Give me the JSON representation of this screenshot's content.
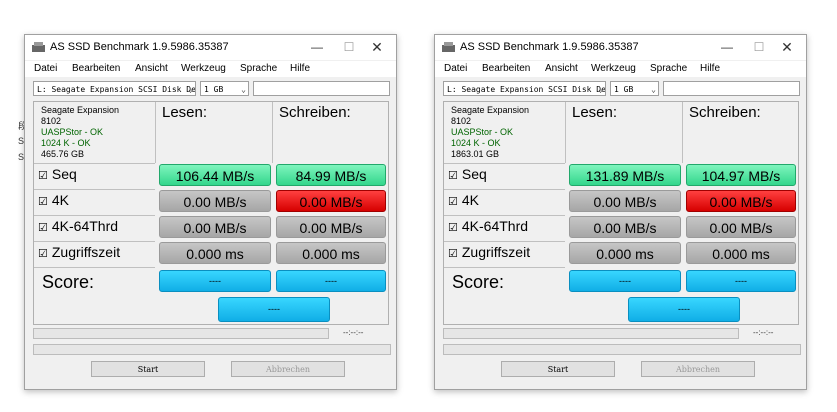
{
  "menu": [
    "Datei",
    "Bearbeiten",
    "Ansicht",
    "Werkzeug",
    "Sprache",
    "Hilfe"
  ],
  "windows": [
    {
      "title": "AS SSD Benchmark 1.9.5986.35387",
      "drive_select": "L: Seagate Expansion SCSI Disk De",
      "size_select": "1 GB",
      "info": {
        "name": "Seagate Expansion",
        "model": "8102",
        "driver": "UASPStor - OK",
        "align": "1024 K - OK",
        "capacity": "465.76 GB"
      },
      "col_read": "Lesen:",
      "col_write": "Schreiben:",
      "rows": [
        {
          "label": "Seq",
          "read": "106.44 MB/s",
          "write": "84.99 MB/s"
        },
        {
          "label": "4K",
          "read": "0.00 MB/s",
          "write": "0.00 MB/s"
        },
        {
          "label": "4K-64Thrd",
          "read": "0.00 MB/s",
          "write": "0.00 MB/s"
        },
        {
          "label": "Zugriffszeit",
          "read": "0.000 ms",
          "write": "0.000 ms"
        }
      ],
      "score_label": "Score:",
      "score_read": "----",
      "score_write": "----",
      "score_total": "----",
      "time": "--:--:--",
      "start_label": "Start",
      "abort_label": "Abbrechen"
    },
    {
      "title": "AS SSD Benchmark 1.9.5986.35387",
      "drive_select": "L: Seagate Expansion SCSI Disk De",
      "size_select": "1 GB",
      "info": {
        "name": "Seagate Expansion",
        "model": "8102",
        "driver": "UASPStor - OK",
        "align": "1024 K - OK",
        "capacity": "1863.01 GB"
      },
      "col_read": "Lesen:",
      "col_write": "Schreiben:",
      "rows": [
        {
          "label": "Seq",
          "read": "131.89 MB/s",
          "write": "104.97 MB/s"
        },
        {
          "label": "4K",
          "read": "0.00 MB/s",
          "write": "0.00 MB/s"
        },
        {
          "label": "4K-64Thrd",
          "read": "0.00 MB/s",
          "write": "0.00 MB/s"
        },
        {
          "label": "Zugriffszeit",
          "read": "0.000 ms",
          "write": "0.000 ms"
        }
      ],
      "score_label": "Score:",
      "score_read": "----",
      "score_write": "----",
      "score_total": "----",
      "time": "--:--:--",
      "start_label": "Start",
      "abort_label": "Abbrechen"
    }
  ],
  "background": [
    "段",
    "S",
    "S"
  ],
  "colors": {
    "seq": "#33d68c",
    "zero": "#a6a6a6",
    "error": "#d60000",
    "score": "#10aee6"
  }
}
